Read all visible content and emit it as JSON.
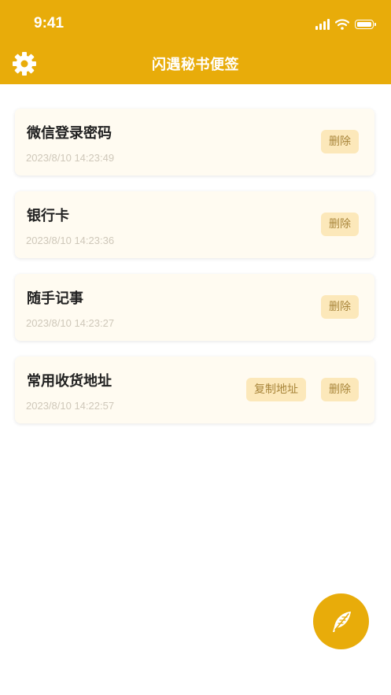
{
  "status_bar": {
    "time": "9:41"
  },
  "header": {
    "title": "闪遇秘书便签",
    "settings_icon": "gear-icon"
  },
  "notes": [
    {
      "title": "微信登录密码",
      "timestamp": "2023/8/10 14:23:49",
      "delete_label": "删除"
    },
    {
      "title": "银行卡",
      "timestamp": "2023/8/10 14:23:36",
      "delete_label": "删除"
    },
    {
      "title": "随手记事",
      "timestamp": "2023/8/10 14:23:27",
      "delete_label": "删除"
    },
    {
      "title": "常用收货地址",
      "timestamp": "2023/8/10 14:22:57",
      "copy_label": "复制地址",
      "delete_label": "删除"
    }
  ],
  "fab": {
    "icon": "feather-icon"
  },
  "colors": {
    "accent": "#E8AC0A",
    "card_bg": "#FFFBF1",
    "button_bg": "#FCE8BA",
    "button_text": "#A8853A"
  }
}
